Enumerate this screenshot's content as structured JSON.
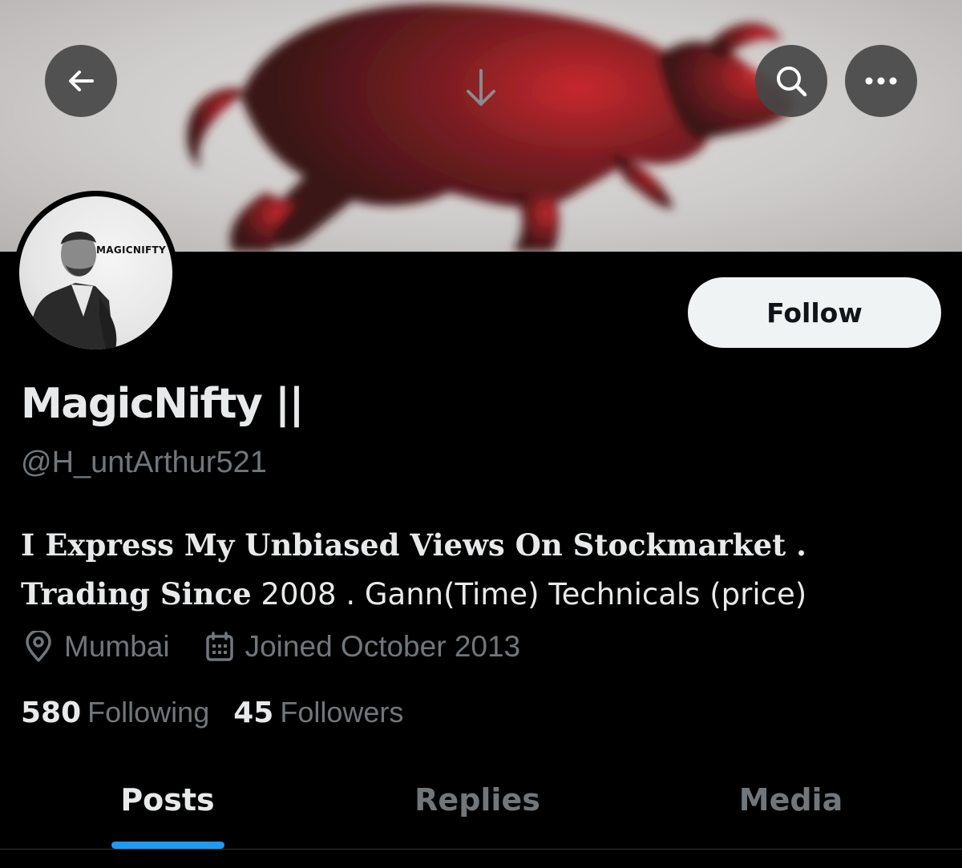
{
  "banner": {
    "accent_color": "#c8282e",
    "image": "bull-silhouette"
  },
  "nav": {
    "back_icon": "arrow-left-icon",
    "pull_icon": "arrow-down-icon",
    "search_icon": "search-icon",
    "more_icon": "more-horizontal-icon"
  },
  "avatar": {
    "badge_text": "MAGICNIFTY"
  },
  "follow": {
    "label": "Follow"
  },
  "profile": {
    "display_name": "MagicNifty ||",
    "handle": "@H_untArthur521",
    "bio_line1": "I Express My Unbiased Views On Stockmarket .",
    "bio_line2_serif": "Trading Since",
    "bio_line2_rest": " 2008 . Gann(Time) Technicals (price)",
    "location": "Mumbai",
    "joined": "Joined October 2013"
  },
  "stats": {
    "following_count": "580",
    "following_label": "Following",
    "followers_count": "45",
    "followers_label": "Followers"
  },
  "tabs": [
    {
      "label": "Posts",
      "active": true
    },
    {
      "label": "Replies",
      "active": false
    },
    {
      "label": "Media",
      "active": false
    }
  ],
  "colors": {
    "accent": "#1d9bf0",
    "muted": "#71767b",
    "text": "#e7e9ea",
    "background": "#000000"
  }
}
